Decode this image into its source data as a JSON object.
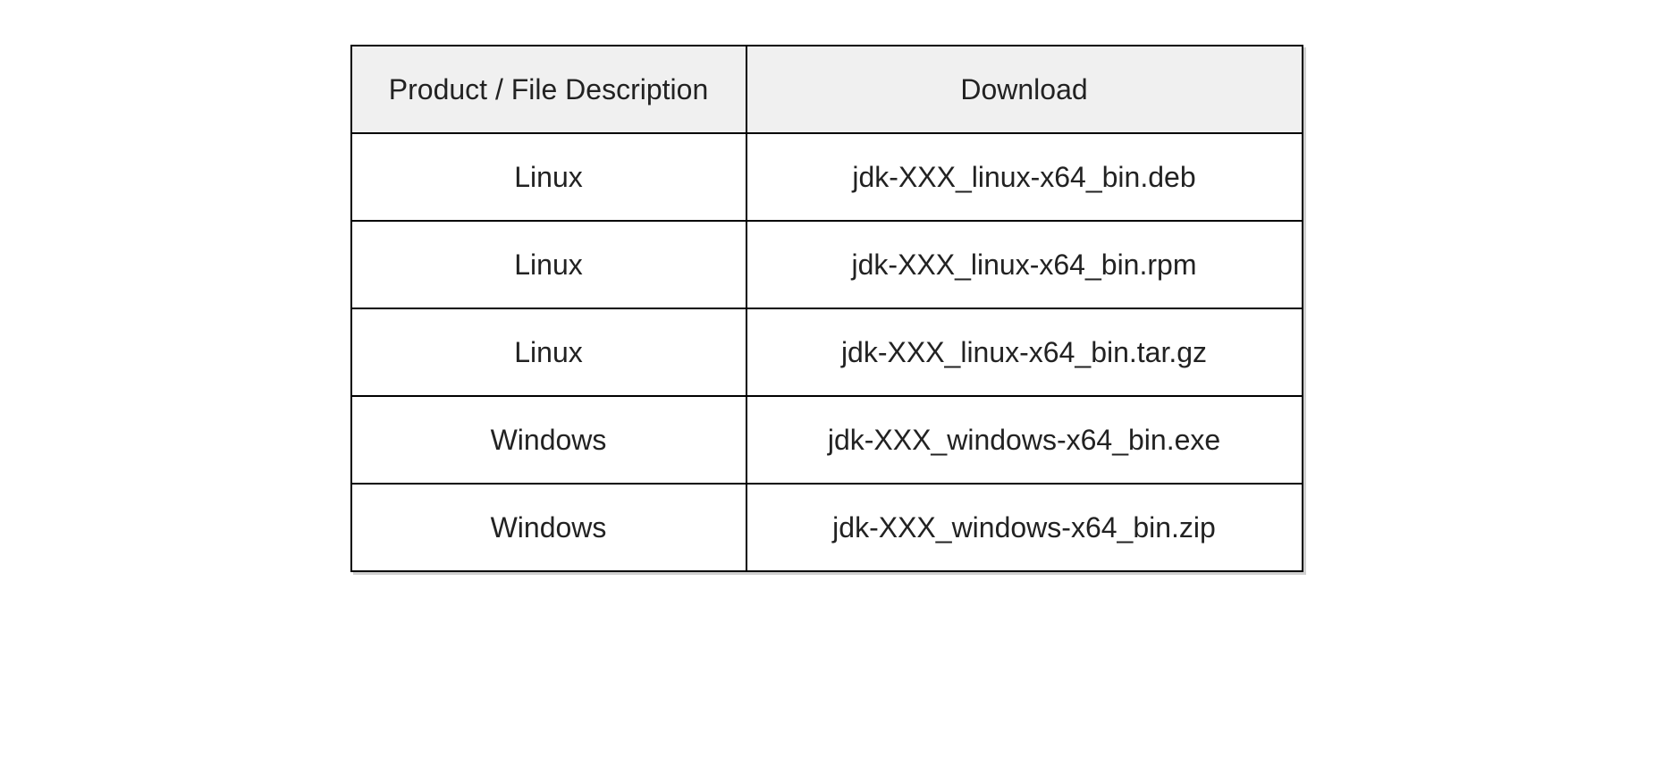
{
  "table": {
    "headers": {
      "product": "Product / File Description",
      "download": "Download"
    },
    "rows": [
      {
        "product": "Linux",
        "download": "jdk-XXX_linux-x64_bin.deb"
      },
      {
        "product": "Linux",
        "download": "jdk-XXX_linux-x64_bin.rpm"
      },
      {
        "product": "Linux",
        "download": "jdk-XXX_linux-x64_bin.tar.gz"
      },
      {
        "product": "Windows",
        "download": "jdk-XXX_windows-x64_bin.exe"
      },
      {
        "product": "Windows",
        "download": "jdk-XXX_windows-x64_bin.zip"
      }
    ]
  }
}
